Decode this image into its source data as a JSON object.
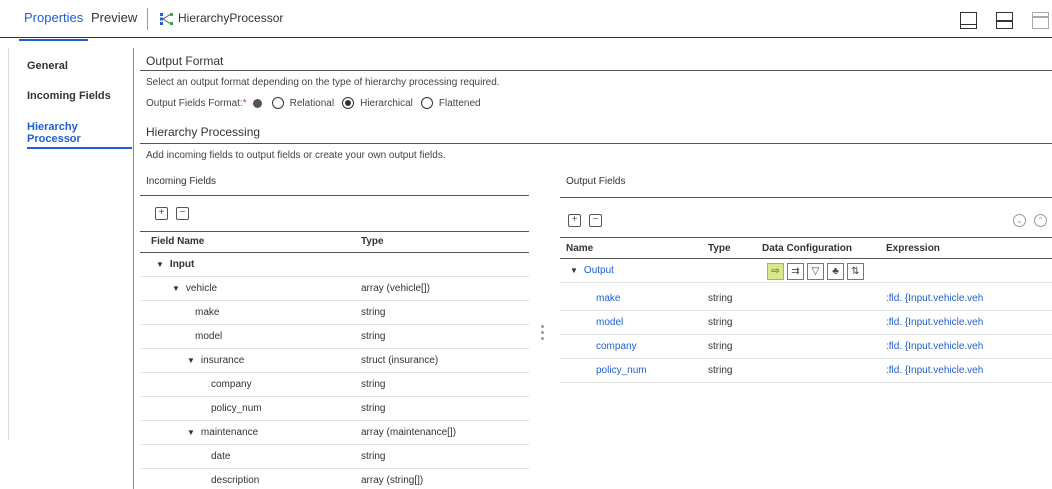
{
  "tabs": {
    "properties": "Properties",
    "preview": "Preview"
  },
  "processor_title": "HierarchyProcessor",
  "nav": {
    "general": "General",
    "incoming": "Incoming Fields",
    "hierarchy": "Hierarchy Processor"
  },
  "output_format": {
    "title": "Output Format",
    "desc": "Select an output format depending on the type of hierarchy processing required.",
    "label": "Output Fields Format:",
    "required_mark": "*",
    "options": [
      "Relational",
      "Hierarchical",
      "Flattened"
    ],
    "selected": "Hierarchical"
  },
  "hierarchy_processing": {
    "title": "Hierarchy Processing",
    "desc": "Add incoming fields to output fields or create your own output fields."
  },
  "incoming": {
    "title": "Incoming Fields",
    "columns": [
      "Field Name",
      "Type"
    ],
    "rows": [
      {
        "name": "Input",
        "type": ""
      },
      {
        "name": "vehicle",
        "type": "array (vehicle[])"
      },
      {
        "name": "make",
        "type": "string"
      },
      {
        "name": "model",
        "type": "string"
      },
      {
        "name": "insurance",
        "type": "struct (insurance)"
      },
      {
        "name": "company",
        "type": "string"
      },
      {
        "name": "policy_num",
        "type": "string"
      },
      {
        "name": "maintenance",
        "type": "array (maintenance[])"
      },
      {
        "name": "date",
        "type": "string"
      },
      {
        "name": "description",
        "type": "array (string[])"
      }
    ]
  },
  "output": {
    "title": "Output Fields",
    "columns": [
      "Name",
      "Type",
      "Data Configuration",
      "Expression"
    ],
    "root": "Output",
    "rows": [
      {
        "name": "make",
        "type": "string",
        "expr": ":fld. {Input.vehicle.veh"
      },
      {
        "name": "model",
        "type": "string",
        "expr": ":fld. {Input.vehicle.veh"
      },
      {
        "name": "company",
        "type": "string",
        "expr": ":fld. {Input.vehicle.veh"
      },
      {
        "name": "policy_num",
        "type": "string",
        "expr": ":fld. {Input.vehicle.veh"
      }
    ]
  },
  "colors": {
    "accent": "#1f5ed8",
    "active_icon": "#d8e98a"
  }
}
